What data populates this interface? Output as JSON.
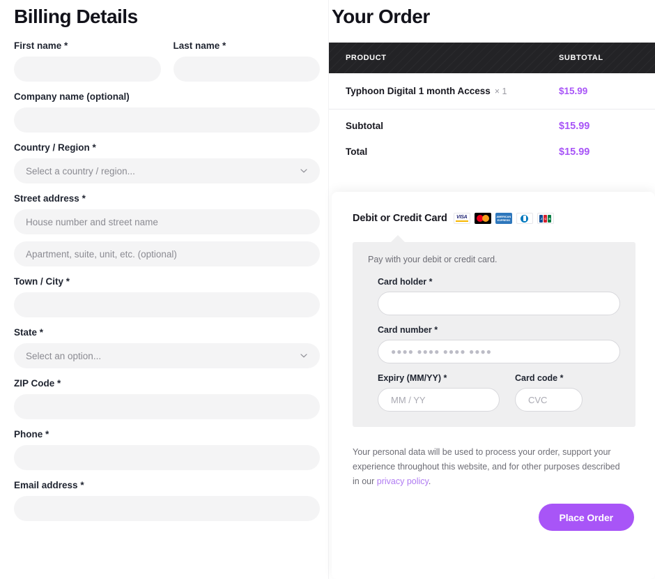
{
  "billing": {
    "title": "Billing Details",
    "fields": [
      {
        "label": "First name",
        "required": true,
        "value": "",
        "placeholder": ""
      },
      {
        "label": "Last name",
        "required": true,
        "value": "",
        "placeholder": ""
      },
      {
        "label": "Company name (optional)",
        "required": false,
        "value": "",
        "placeholder": ""
      },
      {
        "label": "Country / Region",
        "required": true,
        "value": "",
        "placeholder": "Select a country / region..."
      },
      {
        "label": "Street address",
        "required": true,
        "value": "",
        "placeholder": "House number and street name"
      },
      {
        "label": "",
        "required": false,
        "value": "",
        "placeholder": "Apartment, suite, unit, etc. (optional)"
      },
      {
        "label": "Town / City",
        "required": true,
        "value": "",
        "placeholder": ""
      },
      {
        "label": "State",
        "required": true,
        "value": "",
        "placeholder": "Select an option..."
      },
      {
        "label": "ZIP Code",
        "required": true,
        "value": "",
        "placeholder": ""
      },
      {
        "label": "Phone",
        "required": true,
        "value": "",
        "placeholder": ""
      },
      {
        "label": "Email address",
        "required": true,
        "value": "",
        "placeholder": ""
      }
    ],
    "required_marker": "*",
    "chevron_icon": "chevron-down-icon"
  },
  "order": {
    "title": "Your Order",
    "table": {
      "headers": {
        "product": "PRODUCT",
        "subtotal": "SUBTOTAL"
      },
      "items": [
        {
          "name": "Typhoon Digital 1 month Access",
          "quantity": "× 1",
          "price": "$15.99"
        }
      ],
      "totals": [
        {
          "label": "Subtotal",
          "value": "$15.99"
        },
        {
          "label": "Total",
          "value": "$15.99"
        }
      ]
    },
    "header_bg": "#232326"
  },
  "payment": {
    "method_title": "Debit or Credit Card",
    "accepted_cards": [
      {
        "name": "visa-card-icon",
        "label": "VISA"
      },
      {
        "name": "mastercard-card-icon",
        "label": "MC"
      },
      {
        "name": "amex-card-icon",
        "label": "AMERICAN EXPRESS"
      },
      {
        "name": "diners-club-card-icon",
        "label": "Diners"
      },
      {
        "name": "jcb-card-icon",
        "label": "JCB"
      }
    ],
    "description": "Pay with your debit or credit card.",
    "fields": {
      "card_holder": {
        "label": "Card holder",
        "required": true,
        "value": "",
        "placeholder": ""
      },
      "card_number": {
        "label": "Card number",
        "required": true,
        "value": "",
        "placeholder": "●●●● ●●●● ●●●● ●●●●"
      },
      "expiry": {
        "label": "Expiry (MM/YY)",
        "required": true,
        "value": "",
        "placeholder": "MM / YY"
      },
      "card_code": {
        "label": "Card code",
        "required": true,
        "value": "",
        "placeholder": "CVC"
      }
    },
    "required_marker": "*",
    "privacy_text": "Your personal data will be used to process your order, support your experience throughout this website, and for other purposes described in our ",
    "privacy_link": "privacy policy",
    "privacy_tail": ".",
    "place_order_label": "Place Order",
    "accent_color": "#a855f7"
  }
}
